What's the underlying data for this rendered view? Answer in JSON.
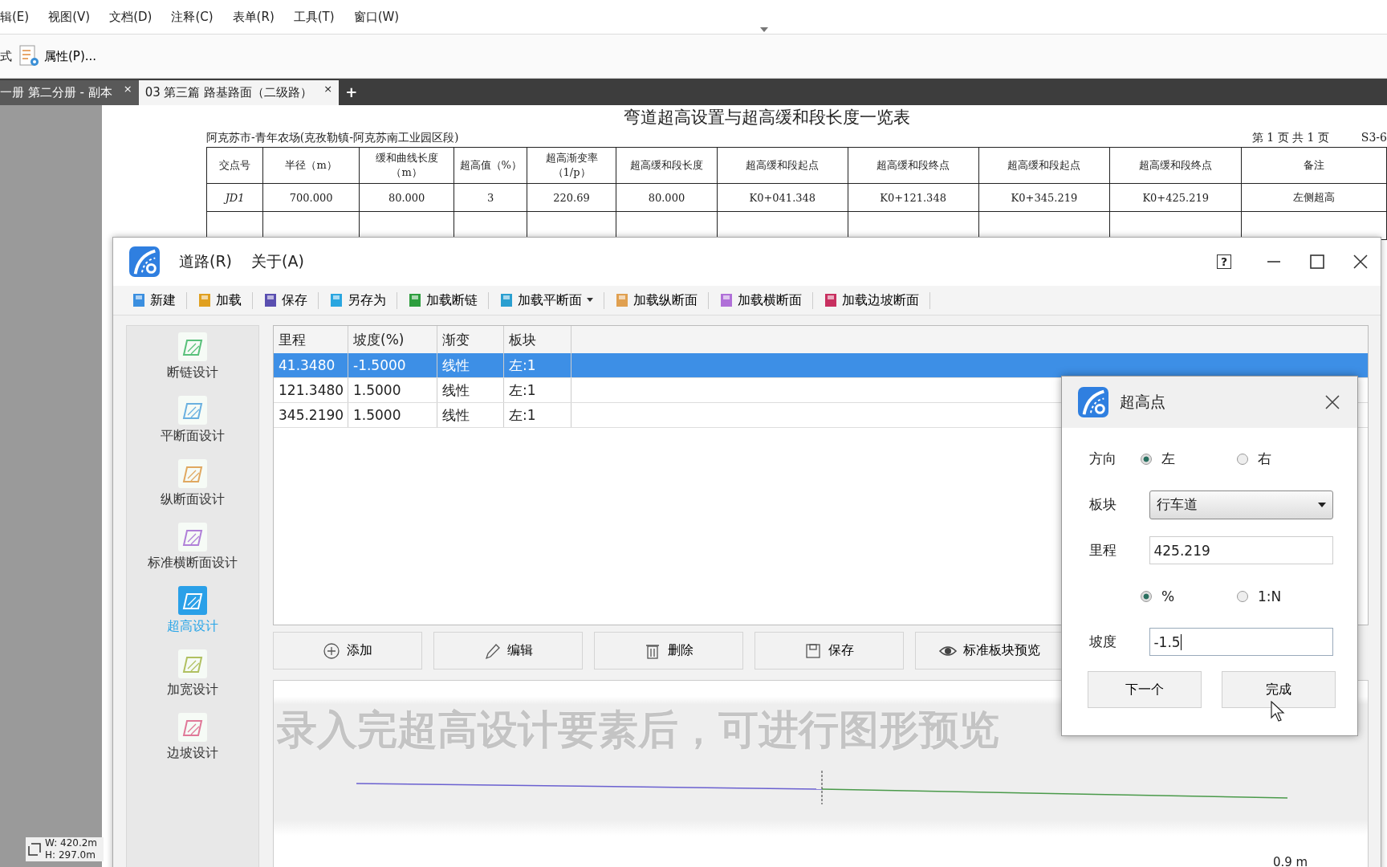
{
  "menu_bar": [
    "辑(E)",
    "视图(V)",
    "文档(D)",
    "注释(C)",
    "表单(R)",
    "工具(T)",
    "窗口(W)"
  ],
  "toolbar": {
    "cut_label": "式",
    "button": "属性(P)..."
  },
  "doc_tabs": [
    {
      "label": "一册 第二分册 - 副本",
      "close": "×",
      "selected": false
    },
    {
      "label": "03 第三篇 路基路面（二级路）",
      "close": "×",
      "selected": true
    }
  ],
  "new_tab": "+",
  "document": {
    "title": "弯道超高设置与超高缓和段长度一览表",
    "subtitle": "阿克苏市-青年农场(克孜勒镇-阿克苏南工业园区段)",
    "page_info": "第 1 页 共 1 页",
    "sheet": "S3-6",
    "table": {
      "columns": [
        "交点号",
        "半径（m）",
        "缓和曲线长度（m）",
        "超高值（%）",
        "超高渐变率（1/p）",
        "超高缓和段长度",
        "超高缓和段起点",
        "超高缓和段终点",
        "超高缓和段起点",
        "超高缓和段终点",
        "备注"
      ],
      "rows": [
        [
          "JD1",
          "700.000",
          "80.000",
          "3",
          "220.69",
          "80.000",
          "K0+041.348",
          "K0+121.348",
          "K0+345.219",
          "K0+425.219",
          "左侧超高"
        ]
      ]
    }
  },
  "app": {
    "menu": [
      "道路(R)",
      "关于(A)"
    ],
    "help": "?",
    "toolbar": [
      {
        "label": "新建",
        "has_menu": false
      },
      {
        "label": "加载",
        "has_menu": false
      },
      {
        "label": "保存",
        "has_menu": false
      },
      {
        "label": "另存为",
        "has_menu": false
      },
      {
        "label": "加载断链",
        "has_menu": false
      },
      {
        "label": "加载平断面",
        "has_menu": true
      },
      {
        "label": "加载纵断面",
        "has_menu": false
      },
      {
        "label": "加载横断面",
        "has_menu": false
      },
      {
        "label": "加载边坡断面",
        "has_menu": false
      }
    ],
    "sidebar": [
      {
        "label": "断链设计",
        "selected": false
      },
      {
        "label": "平断面设计",
        "selected": false
      },
      {
        "label": "纵断面设计",
        "selected": false
      },
      {
        "label": "标准横断面设计",
        "selected": false
      },
      {
        "label": "超高设计",
        "selected": true
      },
      {
        "label": "加宽设计",
        "selected": false
      },
      {
        "label": "边坡设计",
        "selected": false
      }
    ],
    "grid": {
      "columns": [
        "里程",
        "坡度(%)",
        "渐变",
        "板块"
      ],
      "rows": [
        {
          "cells": [
            "41.3480",
            "-1.5000",
            "线性",
            "左:1"
          ],
          "selected": true
        },
        {
          "cells": [
            "121.3480",
            "1.5000",
            "线性",
            "左:1"
          ],
          "selected": false
        },
        {
          "cells": [
            "345.2190",
            "1.5000",
            "线性",
            "左:1"
          ],
          "selected": false
        }
      ]
    },
    "buttons": [
      "添加",
      "编辑",
      "删除",
      "保存",
      "标准板块预览"
    ],
    "preview": {
      "scale_label": "0.9 m"
    }
  },
  "dialog": {
    "title": "超高点",
    "direction": {
      "label": "方向",
      "options": [
        {
          "label": "左",
          "selected": true
        },
        {
          "label": "右",
          "selected": false
        }
      ]
    },
    "block": {
      "label": "板块",
      "value": "行车道"
    },
    "mileage": {
      "label": "里程",
      "value": "425.219"
    },
    "unit": {
      "options": [
        {
          "label": "%",
          "selected": true
        },
        {
          "label": "1:N",
          "selected": false
        }
      ]
    },
    "slope": {
      "label": "坡度",
      "value": "-1.5"
    },
    "buttons": [
      "下一个",
      "完成"
    ]
  },
  "caption": "录入完超高设计要素后，可进行图形预览",
  "status": {
    "width": "W: 420.2m",
    "height": "H: 297.0m"
  }
}
